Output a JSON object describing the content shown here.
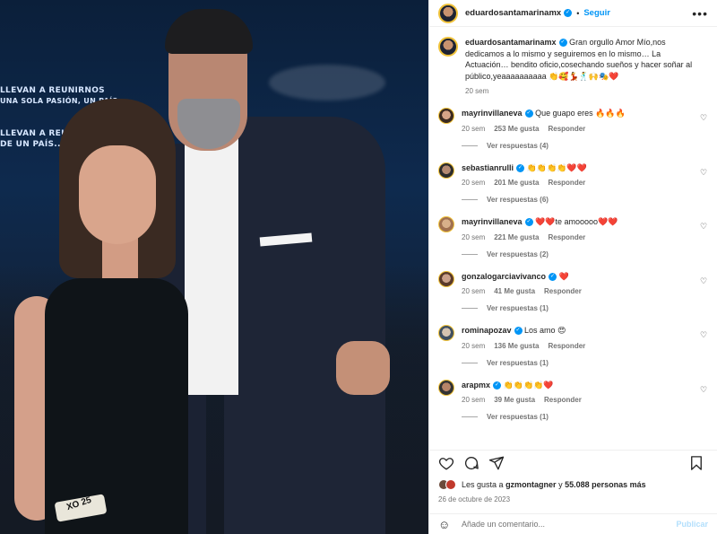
{
  "header": {
    "username": "eduardosantamarinamx",
    "follow_label": "Seguir",
    "separator": "•",
    "more": "•••"
  },
  "photo": {
    "screen_line_1": "LLEVAN A REUNIRNOS",
    "screen_line_2": "UNA SOLA PASIÓN, UN PAÍS...",
    "screen_line_3": "LLEVAN A REUNIRNOS",
    "screen_line_4": "DE UN PAÍS...",
    "wristband_text": "XO 25"
  },
  "caption": {
    "username": "eduardosantamarinamx",
    "text": "Gran orgullo Amor Mío,nos dedicamos a lo mismo y seguiremos en lo mismo… La Actuación… bendito oficio,cosechando sueños y hacer soñar al público,yeaaaaaaaaaa 👏🥰💃🕺🙌🎭❤️",
    "time": "20 sem"
  },
  "comments": [
    {
      "username": "mayrinvillaneva",
      "text": "Que guapo eres 🔥🔥🔥",
      "time": "20 sem",
      "likes": "253 Me gusta",
      "reply": "Responder",
      "replies": "Ver respuestas (4)"
    },
    {
      "username": "sebastianrulli",
      "text": "👏👏👏👏❤️❤️",
      "time": "20 sem",
      "likes": "201 Me gusta",
      "reply": "Responder",
      "replies": "Ver respuestas (6)"
    },
    {
      "username": "mayrinvillaneva",
      "text": "❤️❤️te amooooo❤️❤️",
      "time": "20 sem",
      "likes": "221 Me gusta",
      "reply": "Responder",
      "replies": "Ver respuestas (2)"
    },
    {
      "username": "gonzalogarciavivanco",
      "text": "❤️",
      "time": "20 sem",
      "likes": "41 Me gusta",
      "reply": "Responder",
      "replies": "Ver respuestas (1)"
    },
    {
      "username": "rominapozav",
      "text": "Los amo 😍",
      "time": "20 sem",
      "likes": "136 Me gusta",
      "reply": "Responder",
      "replies": "Ver respuestas (1)"
    },
    {
      "username": "arapmx",
      "text": "👏👏👏👏❤️",
      "time": "20 sem",
      "likes": "39 Me gusta",
      "reply": "Responder",
      "replies": "Ver respuestas (1)"
    }
  ],
  "likes": {
    "prefix": "Les gusta a",
    "user": "gzmontagner",
    "connector": "y",
    "count": "55.088 personas más"
  },
  "date": "26 de octubre de 2023",
  "add_comment": {
    "placeholder": "Añade un comentario...",
    "post_label": "Publicar"
  },
  "colors": {
    "accent": "#0095f6",
    "post_disabled": "#b2dffc",
    "muted": "#737373"
  }
}
